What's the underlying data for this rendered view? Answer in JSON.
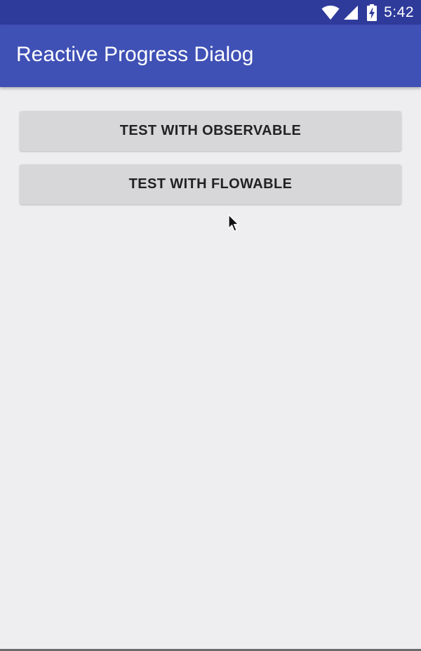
{
  "status_bar": {
    "time": "5:42",
    "icons": [
      "wifi-icon",
      "cellular-signal-icon",
      "battery-charging-icon"
    ],
    "background": "#2f3b9b"
  },
  "app_bar": {
    "title": "Reactive Progress Dialog",
    "background": "#3f51b5"
  },
  "buttons": {
    "observable_label": "TEST WITH OBSERVABLE",
    "flowable_label": "TEST WITH FLOWABLE"
  },
  "colors": {
    "screen_background": "#eeedef",
    "button_background": "#d7d6d8",
    "button_text": "#222222"
  }
}
